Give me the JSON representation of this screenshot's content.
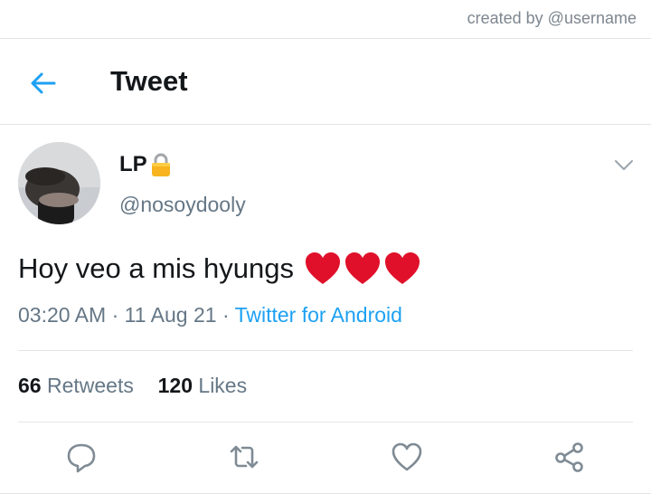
{
  "watermark": "created by @username",
  "header": {
    "title": "Tweet"
  },
  "author": {
    "name": "LP",
    "handle": "@nosoydooly"
  },
  "tweet": {
    "text": "Hoy veo a mis hyungs",
    "time": "03:20 AM",
    "date": "11 Aug 21",
    "source": "Twitter for Android"
  },
  "stats": {
    "retweets_count": "66",
    "retweets_label": "Retweets",
    "likes_count": "120",
    "likes_label": "Likes"
  },
  "icons": {
    "back": "arrow-left-icon",
    "lock": "lock-icon",
    "more": "chevron-down-icon",
    "reply": "reply-icon",
    "retweet": "retweet-icon",
    "like": "heart-icon",
    "share": "share-icon"
  },
  "colors": {
    "accent": "#1da1f2",
    "muted": "#657786",
    "heart": "#e0102a"
  }
}
